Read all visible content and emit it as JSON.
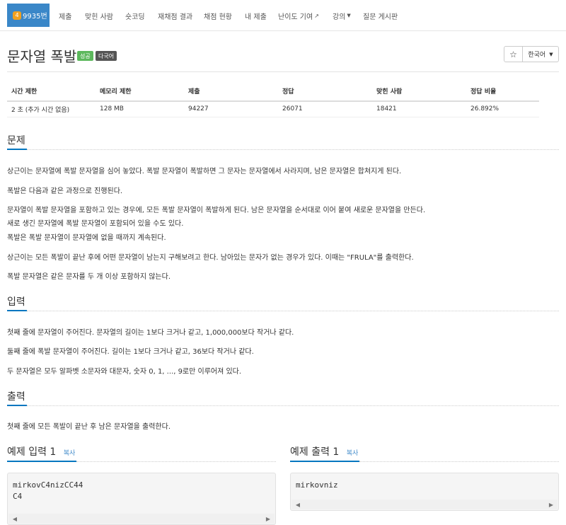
{
  "nav": {
    "problem_id": "9935번",
    "badge_level": "4",
    "items": [
      {
        "label": "제출"
      },
      {
        "label": "맞힌 사람"
      },
      {
        "label": "숏코딩"
      },
      {
        "label": "재채점 결과"
      },
      {
        "label": "채점 현황"
      },
      {
        "label": "내 제출"
      },
      {
        "label": "난이도 기여"
      },
      {
        "label": "강의"
      },
      {
        "label": "질문 게시판"
      }
    ]
  },
  "problem": {
    "title": "문자열 폭발",
    "label_success": "성공",
    "label_multilang": "다국어",
    "lang_select": "한국어"
  },
  "info": {
    "headers": [
      "시간 제한",
      "메모리 제한",
      "제출",
      "정답",
      "맞힌 사람",
      "정답 비율"
    ],
    "values": [
      "2 초 (추가 시간 없음)",
      "128 MB",
      "94227",
      "26071",
      "18421",
      "26.892%"
    ]
  },
  "sections": {
    "desc_title": "문제",
    "desc": [
      "상근이는 문자열에 폭발 문자열을 심어 놓았다. 폭발 문자열이 폭발하면 그 문자는 문자열에서 사라지며, 남은 문자열은 합쳐지게 된다.",
      "폭발은 다음과 같은 과정으로 진행된다.",
      "문자열이 폭발 문자열을 포함하고 있는 경우에, 모든 폭발 문자열이 폭발하게 된다. 남은 문자열을 순서대로 이어 붙여 새로운 문자열을 만든다.",
      "새로 생긴 문자열에 폭발 문자열이 포함되어 있을 수도 있다.",
      "폭발은 폭발 문자열이 문자열에 없을 때까지 계속된다.",
      "상근이는 모든 폭발이 끝난 후에 어떤 문자열이 남는지 구해보려고 한다. 남아있는 문자가 없는 경우가 있다. 이때는 \"FRULA\"를 출력한다.",
      "폭발 문자열은 같은 문자를 두 개 이상 포함하지 않는다."
    ],
    "input_title": "입력",
    "input": [
      "첫째 줄에 문자열이 주어진다. 문자열의 길이는 1보다 크거나 같고, 1,000,000보다 작거나 같다.",
      "둘째 줄에 폭발 문자열이 주어진다. 길이는 1보다 크거나 같고, 36보다 작거나 같다.",
      "두 문자열은 모두 알파벳 소문자와 대문자, 숫자 0, 1, ..., 9로만 이루어져 있다."
    ],
    "output_title": "출력",
    "output": [
      "첫째 줄에 모든 폭발이 끝난 후 남은 문자열을 출력한다."
    ]
  },
  "samples": {
    "input_title": "예제 입력 1",
    "output_title": "예제 출력 1",
    "copy_label": "복사",
    "input_lines": [
      "mirkovC4nizCC44",
      "C4"
    ],
    "output_lines": [
      "mirkovniz"
    ]
  }
}
